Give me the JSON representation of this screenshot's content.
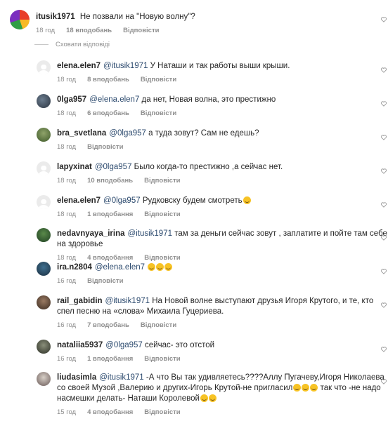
{
  "ui": {
    "hide_replies": "Сховати відповіді",
    "reply_label": "Відповісти"
  },
  "top_comment": {
    "user": "itusik1971",
    "text": "Не позвали на \"Новую волну\"?",
    "time": "18 год",
    "likes": "18 вподобань"
  },
  "replies": [
    {
      "user": "elena.elen7",
      "mention": "@itusik1971",
      "text": " У Наташи и так работы выши крыши.",
      "time": "18 год",
      "likes": "8 вподобань",
      "avatar": "blank"
    },
    {
      "user": "0lga957",
      "mention": "@elena.elen7",
      "text": " да нет, Новая волна, это престижно",
      "time": "18 год",
      "likes": "6 вподобань",
      "avatar": "photo1"
    },
    {
      "user": "bra_svetlana",
      "mention": "@0lga957",
      "text": " а туда зовут? Сам не едешь?",
      "time": "18 год",
      "likes": "",
      "avatar": "photo2"
    },
    {
      "user": "lapyxinat",
      "mention": "@0lga957",
      "text": " Было когда-то престижно ,а сейчас нет.",
      "time": "18 год",
      "likes": "10 вподобань",
      "avatar": "blank"
    },
    {
      "user": "elena.elen7",
      "mention": "@0lga957",
      "text": " Рудковску будем смотреть",
      "time": "18 год",
      "likes": "1 вподобання",
      "avatar": "blank",
      "emoji_count": 1
    },
    {
      "user": "nedavnyaya_irina",
      "mention": "@itusik1971",
      "text": "  там за деньги сейчас зовут , заплатите  и пойте  там себе на здоровье",
      "time": "18 год",
      "likes": "4 вподобання",
      "avatar": "photo3"
    },
    {
      "user": "ira.n2804",
      "mention": "@elena.elen7",
      "text": " ",
      "time": "16 год",
      "likes": "",
      "avatar": "photo4",
      "emoji_count": 3
    },
    {
      "user": "rail_gabidin",
      "mention": "@itusik1971",
      "text": " На Новой волне выступают друзья Игоря Крутого, и те, кто спел песню на «слова» Михаила Гуцериева.",
      "time": "16 год",
      "likes": "7 вподобань",
      "avatar": "photo5"
    },
    {
      "user": "nataliia5937",
      "mention": "@0lga957",
      "text": " сейчас- это отстой",
      "time": "16 год",
      "likes": "1 вподобання",
      "avatar": "photo6"
    },
    {
      "user": "liudasimla",
      "mention": "@itusik1971",
      "text": " -А что Вы так удивляетесь????Аллу Пугачеву,Игоря Николаева со своей Музой ,Валерию и других-Игорь Крутой-не пригласил",
      "text2": " так что -не надо насмешки делать- Наташи Королевой",
      "time": "15 год",
      "likes": "4 вподобання",
      "avatar": "photo7",
      "emoji_count": 3,
      "emoji_count2": 2
    }
  ],
  "colors": {
    "mention": "#2c4a6e",
    "meta": "#8e8e8e",
    "text": "#262626"
  }
}
